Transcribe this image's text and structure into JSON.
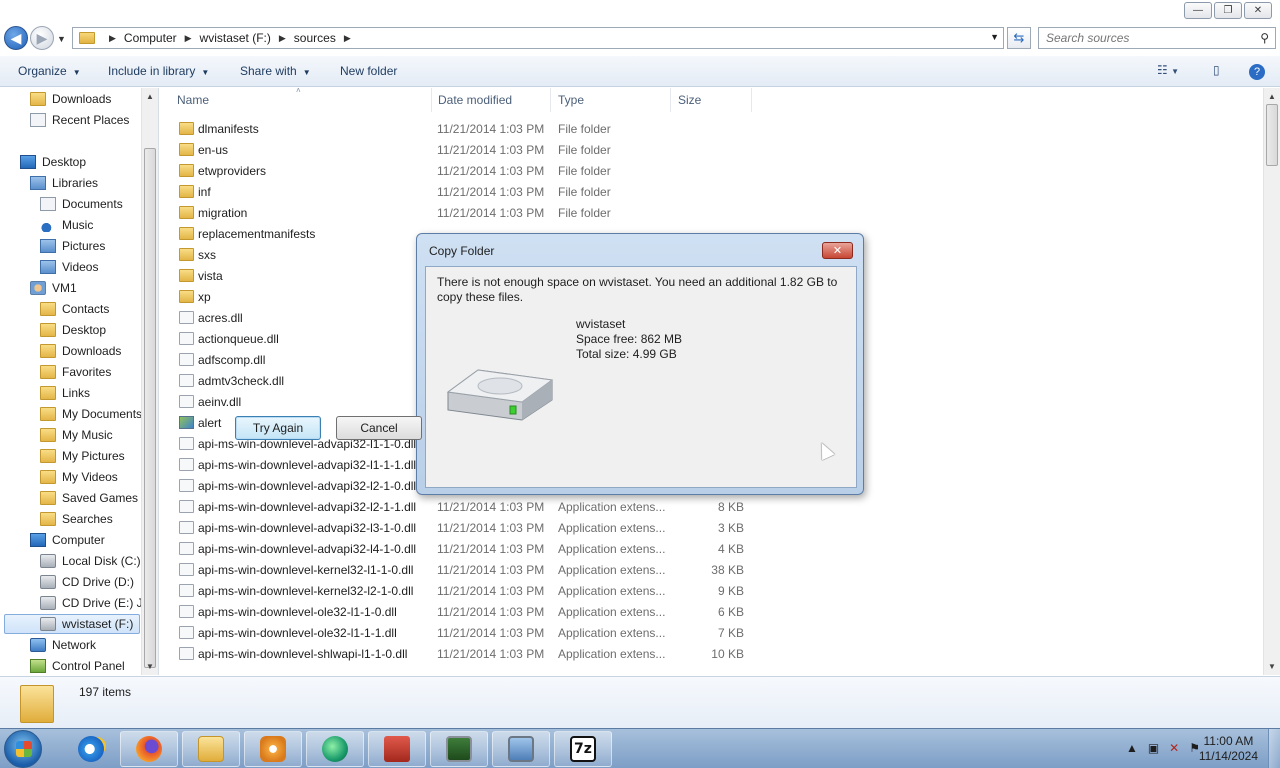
{
  "window": {
    "caption_buttons": {
      "minimize": "—",
      "maximize": "❐",
      "close": "✕"
    }
  },
  "address": {
    "crumbs": [
      "Computer",
      "wvistaset (F:)",
      "sources"
    ],
    "search_placeholder": "Search sources"
  },
  "toolbar": {
    "organize": "Organize",
    "include_in_library": "Include in library",
    "share_with": "Share with",
    "new_folder": "New folder"
  },
  "nav_pane": {
    "items": [
      {
        "label": "Downloads",
        "icon": "downloads-icon"
      },
      {
        "label": "Recent Places",
        "icon": "recent-places-icon"
      },
      {
        "label": "Desktop",
        "icon": "desktop-icon"
      },
      {
        "label": "Libraries",
        "icon": "libraries-icon"
      },
      {
        "label": "Documents",
        "icon": "documents-icon"
      },
      {
        "label": "Music",
        "icon": "music-icon"
      },
      {
        "label": "Pictures",
        "icon": "pictures-icon"
      },
      {
        "label": "Videos",
        "icon": "videos-icon"
      },
      {
        "label": "VM1",
        "icon": "user-icon"
      },
      {
        "label": "Contacts",
        "icon": "contacts-icon"
      },
      {
        "label": "Desktop",
        "icon": "desktop-folder-icon"
      },
      {
        "label": "Downloads",
        "icon": "downloads-folder-icon"
      },
      {
        "label": "Favorites",
        "icon": "favorites-icon"
      },
      {
        "label": "Links",
        "icon": "links-icon"
      },
      {
        "label": "My Documents",
        "icon": "my-documents-icon"
      },
      {
        "label": "My Music",
        "icon": "my-music-icon"
      },
      {
        "label": "My Pictures",
        "icon": "my-pictures-icon"
      },
      {
        "label": "My Videos",
        "icon": "my-videos-icon"
      },
      {
        "label": "Saved Games",
        "icon": "saved-games-icon"
      },
      {
        "label": "Searches",
        "icon": "searches-icon"
      },
      {
        "label": "Computer",
        "icon": "computer-icon"
      },
      {
        "label": "Local Disk (C:)",
        "icon": "local-disk-icon"
      },
      {
        "label": "CD Drive (D:)",
        "icon": "cd-drive-icon"
      },
      {
        "label": "CD Drive (E:) J_",
        "icon": "cd-drive-icon"
      },
      {
        "label": "wvistaset (F:)",
        "icon": "usb-drive-icon"
      },
      {
        "label": "Network",
        "icon": "network-icon"
      },
      {
        "label": "Control Panel",
        "icon": "control-panel-icon"
      }
    ]
  },
  "columns": {
    "name": "Name",
    "date": "Date modified",
    "type": "Type",
    "size": "Size"
  },
  "files": [
    {
      "name": "dlmanifests",
      "date": "11/21/2014 1:03 PM",
      "type": "File folder",
      "size": "",
      "kind": "folder"
    },
    {
      "name": "en-us",
      "date": "11/21/2014 1:03 PM",
      "type": "File folder",
      "size": "",
      "kind": "folder"
    },
    {
      "name": "etwproviders",
      "date": "11/21/2014 1:03 PM",
      "type": "File folder",
      "size": "",
      "kind": "folder"
    },
    {
      "name": "inf",
      "date": "11/21/2014 1:03 PM",
      "type": "File folder",
      "size": "",
      "kind": "folder"
    },
    {
      "name": "migration",
      "date": "11/21/2014 1:03 PM",
      "type": "File folder",
      "size": "",
      "kind": "folder"
    },
    {
      "name": "replacementmanifests",
      "date": "",
      "type": "",
      "size": "",
      "kind": "folder"
    },
    {
      "name": "sxs",
      "date": "",
      "type": "",
      "size": "",
      "kind": "folder"
    },
    {
      "name": "vista",
      "date": "",
      "type": "",
      "size": "",
      "kind": "folder"
    },
    {
      "name": "xp",
      "date": "",
      "type": "",
      "size": "",
      "kind": "folder"
    },
    {
      "name": "acres.dll",
      "date": "",
      "type": "",
      "size": "",
      "kind": "dll"
    },
    {
      "name": "actionqueue.dll",
      "date": "",
      "type": "",
      "size": "",
      "kind": "dll"
    },
    {
      "name": "adfscomp.dll",
      "date": "",
      "type": "",
      "size": "",
      "kind": "dll"
    },
    {
      "name": "admtv3check.dll",
      "date": "",
      "type": "",
      "size": "",
      "kind": "dll"
    },
    {
      "name": "aeinv.dll",
      "date": "",
      "type": "",
      "size": "",
      "kind": "dll"
    },
    {
      "name": "alert",
      "date": "",
      "type": "",
      "size": "",
      "kind": "img"
    },
    {
      "name": "api-ms-win-downlevel-advapi32-l1-1-0.dll",
      "date": "",
      "type": "",
      "size": "",
      "kind": "dll"
    },
    {
      "name": "api-ms-win-downlevel-advapi32-l1-1-1.dll",
      "date": "",
      "type": "",
      "size": "",
      "kind": "dll"
    },
    {
      "name": "api-ms-win-downlevel-advapi32-l2-1-0.dll",
      "date": "",
      "type": "",
      "size": "",
      "kind": "dll"
    },
    {
      "name": "api-ms-win-downlevel-advapi32-l2-1-1.dll",
      "date": "11/21/2014 1:03 PM",
      "type": "Application extens...",
      "size": "8 KB",
      "kind": "dll"
    },
    {
      "name": "api-ms-win-downlevel-advapi32-l3-1-0.dll",
      "date": "11/21/2014 1:03 PM",
      "type": "Application extens...",
      "size": "3 KB",
      "kind": "dll"
    },
    {
      "name": "api-ms-win-downlevel-advapi32-l4-1-0.dll",
      "date": "11/21/2014 1:03 PM",
      "type": "Application extens...",
      "size": "4 KB",
      "kind": "dll"
    },
    {
      "name": "api-ms-win-downlevel-kernel32-l1-1-0.dll",
      "date": "11/21/2014 1:03 PM",
      "type": "Application extens...",
      "size": "38 KB",
      "kind": "dll"
    },
    {
      "name": "api-ms-win-downlevel-kernel32-l2-1-0.dll",
      "date": "11/21/2014 1:03 PM",
      "type": "Application extens...",
      "size": "9 KB",
      "kind": "dll"
    },
    {
      "name": "api-ms-win-downlevel-ole32-l1-1-0.dll",
      "date": "11/21/2014 1:03 PM",
      "type": "Application extens...",
      "size": "6 KB",
      "kind": "dll"
    },
    {
      "name": "api-ms-win-downlevel-ole32-l1-1-1.dll",
      "date": "11/21/2014 1:03 PM",
      "type": "Application extens...",
      "size": "7 KB",
      "kind": "dll"
    },
    {
      "name": "api-ms-win-downlevel-shlwapi-l1-1-0.dll",
      "date": "11/21/2014 1:03 PM",
      "type": "Application extens...",
      "size": "10 KB",
      "kind": "dll"
    }
  ],
  "details": {
    "count": "197 items"
  },
  "dialog": {
    "title": "Copy Folder",
    "close": "✕",
    "message": "There is not enough space on wvistaset. You need an additional 1.82 GB to copy these files.",
    "drive_name": "wvistaset",
    "space_free": "Space free: 862 MB",
    "total_size": "Total size: 4.99 GB",
    "try_again": "Try Again",
    "cancel": "Cancel"
  },
  "taskbar": {
    "apps": [
      "internet-explorer-icon",
      "firefox-icon",
      "windows-explorer-icon",
      "media-player-icon",
      "green-globe-icon",
      "toolbox-icon",
      "system-monitor-icon",
      "computer-network-icon",
      "7zip-icon"
    ],
    "seven_zip_label": "7z",
    "time": "11:00 AM",
    "date": "11/14/2024"
  }
}
